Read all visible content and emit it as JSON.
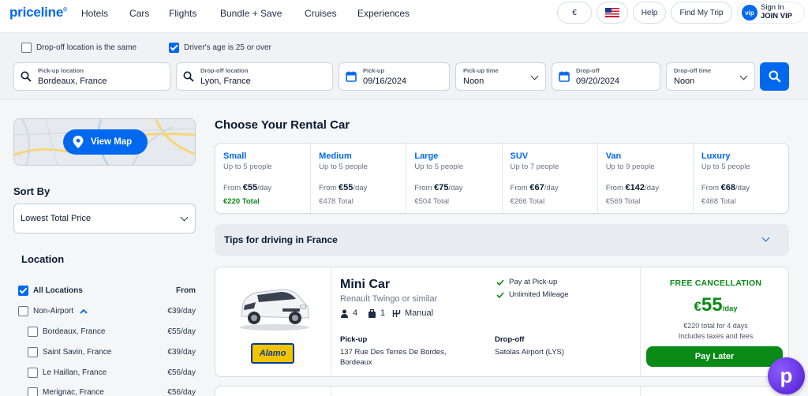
{
  "header": {
    "logo": "priceline",
    "nav": [
      "Hotels",
      "Cars",
      "Flights",
      "Bundle + Save",
      "Cruises",
      "Experiences"
    ],
    "currency": "€",
    "help": "Help",
    "find_trip": "Find My Trip",
    "vip_badge": "vip",
    "signin": "Sign In",
    "join": "JOIN VIP"
  },
  "search": {
    "dropoff_same_label": "Drop-off location is the same",
    "dropoff_same_checked": false,
    "age_label": "Driver's age is 25 or over",
    "age_checked": true,
    "pickup_location_label": "Pick-up location",
    "pickup_location": "Bordeaux, France",
    "dropoff_location_label": "Drop-off location",
    "dropoff_location": "Lyon, France",
    "pickup_date_label": "Pick-up",
    "pickup_date": "09/16/2024",
    "pickup_time_label": "Pick-up time",
    "pickup_time": "Noon",
    "dropoff_date_label": "Drop-off",
    "dropoff_date": "09/20/2024",
    "dropoff_time_label": "Drop-off time",
    "dropoff_time": "Noon"
  },
  "sidebar": {
    "view_map": "View Map",
    "sort_by_heading": "Sort By",
    "sort_value": "Lowest Total Price",
    "location_heading": "Location",
    "all_locations": "All Locations",
    "from_label": "From",
    "non_airport": "Non-Airport",
    "non_airport_price": "€39/day",
    "locations": [
      {
        "name": "Bordeaux, France",
        "price": "€55/day"
      },
      {
        "name": "Saint Savin, France",
        "price": "€39/day"
      },
      {
        "name": "Le Haillan, France",
        "price": "€56/day"
      },
      {
        "name": "Merignac, France",
        "price": "€56/day"
      }
    ]
  },
  "main": {
    "title": "Choose Your Rental Car",
    "categories": [
      {
        "name": "Small",
        "people": "Up to 5 people",
        "from": "From",
        "price": "€55",
        "per": "/day",
        "total": "€220 Total",
        "highlight": true
      },
      {
        "name": "Medium",
        "people": "Up to 5 people",
        "from": "From",
        "price": "€55",
        "per": "/day",
        "total": "€478 Total",
        "highlight": false
      },
      {
        "name": "Large",
        "people": "Up to 5 people",
        "from": "From",
        "price": "€75",
        "per": "/day",
        "total": "€504 Total",
        "highlight": false
      },
      {
        "name": "SUV",
        "people": "Up to 7 people",
        "from": "From",
        "price": "€67",
        "per": "/day",
        "total": "€266 Total",
        "highlight": false
      },
      {
        "name": "Van",
        "people": "Up to 9 people",
        "from": "From",
        "price": "€142",
        "per": "/day",
        "total": "€569 Total",
        "highlight": false
      },
      {
        "name": "Luxury",
        "people": "Up to 5 people",
        "from": "From",
        "price": "€68",
        "per": "/day",
        "total": "€468 Total",
        "highlight": false
      }
    ],
    "tips": "Tips for driving in France"
  },
  "listing": {
    "car_name": "Mini Car",
    "car_similar": "Renault Twingo or similar",
    "seats": "4",
    "bags": "1",
    "transmission": "Manual",
    "vendor": "Alamo",
    "features": [
      "Pay at Pick-up",
      "Unlimited Mileage"
    ],
    "pickup_heading": "Pick-up",
    "pickup_address_1": "137 Rue Des Terres De Bordes,",
    "pickup_address_2": "Bordeaux",
    "dropoff_heading": "Drop-off",
    "dropoff_address": "Satolas Airport (LYS)",
    "free_cancel": "FREE CANCELLATION",
    "currency": "€",
    "price": "55",
    "per": "/day",
    "total_line": "€220 total for 4 days",
    "taxes_line": "Includes taxes and fees",
    "pay_later": "Pay Later"
  },
  "colors": {
    "brand": "#0068ef",
    "green": "#0a8a16"
  }
}
